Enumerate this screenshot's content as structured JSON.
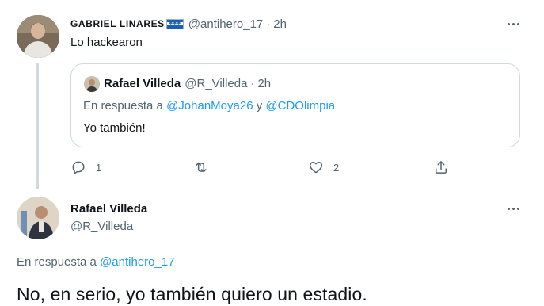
{
  "tweet1": {
    "author_name": "GABRIEL LINARES",
    "flag_icon": "honduras-flag-icon",
    "handle": "@antihero_17",
    "separator": "·",
    "time": "2h",
    "text": "Lo hackearon",
    "actions": {
      "reply_count": "1",
      "retweet_count": "",
      "like_count": "2"
    }
  },
  "quote": {
    "author_name": "Rafael Villeda",
    "handle": "@R_Villeda",
    "separator": "·",
    "time": "2h",
    "reply_prefix": "En respuesta a",
    "reply_user1": "@JohanMoya26",
    "reply_conj": "y",
    "reply_user2": "@CDOlimpia",
    "text": "Yo también!"
  },
  "tweet2": {
    "author_name": "Rafael Villeda",
    "handle": "@R_Villeda",
    "reply_prefix": "En respuesta a",
    "reply_user": "@antihero_17",
    "text": "No, en serio, yo también quiero un estadio."
  },
  "colors": {
    "link": "#1d9bf0",
    "muted": "#536471",
    "text": "#0f1419",
    "border": "#cfd9de"
  }
}
